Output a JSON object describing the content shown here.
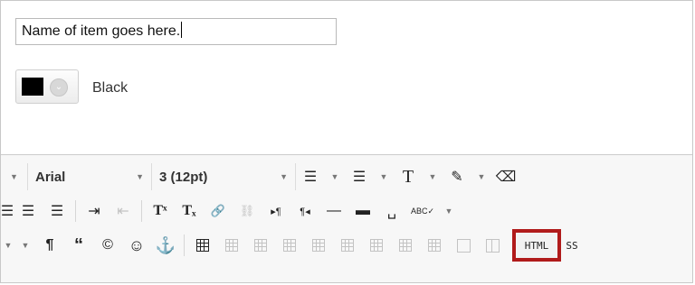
{
  "name_field": {
    "value": "Name of item goes here."
  },
  "color": {
    "label": "Black",
    "swatch": "#000000"
  },
  "toolbar": {
    "font_family": "Arial",
    "font_size": "3 (12pt)",
    "row1": {
      "bullet_list": "☰",
      "numbered_list": "☰",
      "text_color": "T",
      "highlight": "✎",
      "eraser": "⌫"
    },
    "row2": {
      "align_left": "☰",
      "align_center": "☰",
      "align_justify": "☰",
      "indent": "⇥",
      "outdent": "⇤",
      "superscript": "Tˣ",
      "subscript": "Tₓ",
      "link": "🔗",
      "unlink": "⛓",
      "ltr": "▸¶",
      "rtl": "¶◂",
      "hr": "—",
      "hr_thick": "▬",
      "nbsp": "␣",
      "spellcheck": "ABC✓"
    },
    "row3": {
      "pilcrow": "¶",
      "quote": "“",
      "copyright": "©",
      "emoticon": "☺",
      "anchor": "⚓",
      "html_label": "HTML",
      "css_label": "SS"
    }
  },
  "colors": {
    "html_highlight": "#b01a1a"
  }
}
